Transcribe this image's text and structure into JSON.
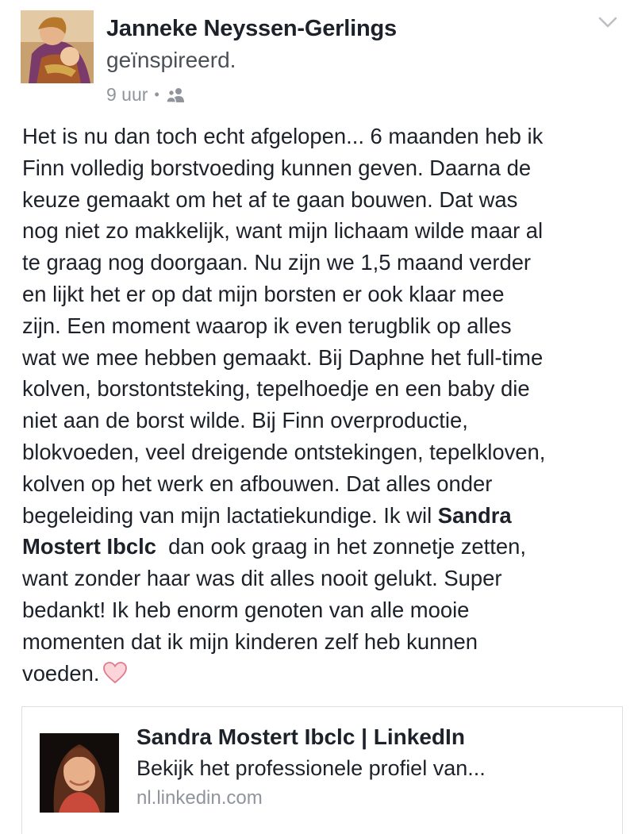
{
  "post": {
    "author": "Janneke Neyssen-Gerlings",
    "feeling": "geïnspireerd.",
    "time": "9 uur",
    "separator": "•",
    "audience_icon": "friends-icon",
    "menu_icon": "chevron-down-icon",
    "lines": [
      "Het is nu dan toch echt afgelopen... 6 maanden heb ik",
      "Finn volledig borstvoeding kunnen geven. Daarna de",
      "keuze gemaakt om het af te gaan bouwen. Dat was",
      "nog niet zo makkelijk, want mijn lichaam wilde maar al",
      "te graag nog doorgaan. Nu zijn we 1,5 maand verder",
      "en lijkt het er op dat mijn borsten er ook klaar mee",
      "zijn. Een moment waarop ik even terugblik op alles",
      "wat we mee hebben gemaakt. Bij Daphne het full-time",
      "kolven, borstontsteking, tepelhoedje en een baby die",
      "niet aan de borst wilde. Bij Finn overproductie,",
      "blokvoeden, veel dreigende ontstekingen, tepelkloven,",
      "kolven op het werk en afbouwen. Dat alles onder"
    ],
    "line13_text": "begeleiding van mijn lactatiekundige. Ik wil ",
    "mention_part1": "Sandra",
    "mention_part2": "Mostert Ibclc",
    "line14_rest": "  dan ook graag in het zonnetje zetten,",
    "lines_after": [
      "want zonder haar was dit alles nooit gelukt. Super",
      "bedankt! Ik heb enorm genoten van alle mooie",
      "momenten dat ik mijn kinderen zelf heb kunnen"
    ],
    "last_line": "voeden.",
    "emoji_icon": "heart-icon"
  },
  "link_preview": {
    "title": "Sandra Mostert Ibclc | LinkedIn",
    "description": "Bekijk het professionele profiel van...",
    "domain": "nl.linkedin.com"
  },
  "colors": {
    "text": "#1d2129",
    "secondary": "#90949c",
    "heart": "#f4a6b0",
    "border": "#dddfe2"
  }
}
